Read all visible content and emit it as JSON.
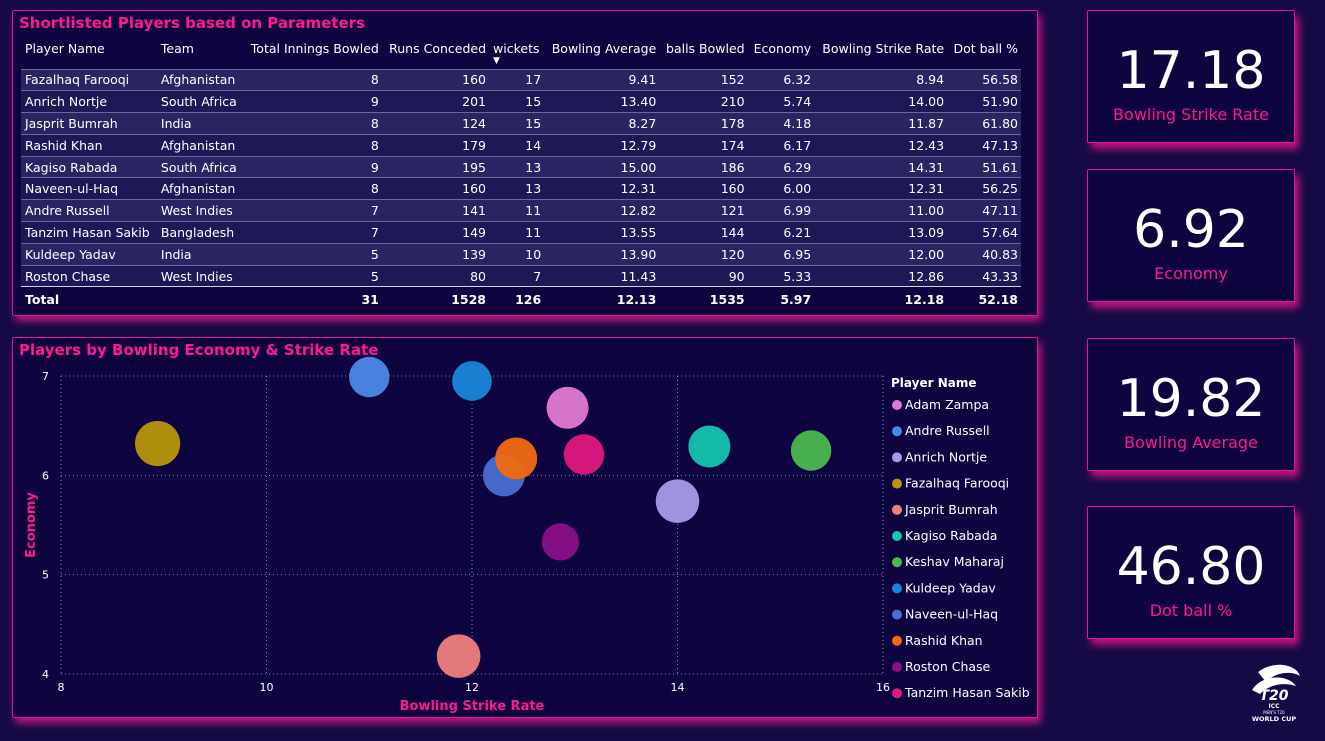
{
  "table": {
    "title": "Shortlisted Players based on Parameters",
    "columns": [
      "Player Name",
      "Team",
      "Total Innings Bowled",
      "Runs Conceded",
      "wickets",
      "Bowling Average",
      "balls Bowled",
      "Economy",
      "Bowling Strike Rate",
      "Dot ball %"
    ],
    "rows": [
      [
        "Fazalhaq Farooqi",
        "Afghanistan",
        "8",
        "160",
        "17",
        "9.41",
        "152",
        "6.32",
        "8.94",
        "56.58"
      ],
      [
        "Anrich Nortje",
        "South Africa",
        "9",
        "201",
        "15",
        "13.40",
        "210",
        "5.74",
        "14.00",
        "51.90"
      ],
      [
        "Jasprit Bumrah",
        "India",
        "8",
        "124",
        "15",
        "8.27",
        "178",
        "4.18",
        "11.87",
        "61.80"
      ],
      [
        "Rashid Khan",
        "Afghanistan",
        "8",
        "179",
        "14",
        "12.79",
        "174",
        "6.17",
        "12.43",
        "47.13"
      ],
      [
        "Kagiso Rabada",
        "South Africa",
        "9",
        "195",
        "13",
        "15.00",
        "186",
        "6.29",
        "14.31",
        "51.61"
      ],
      [
        "Naveen-ul-Haq",
        "Afghanistan",
        "8",
        "160",
        "13",
        "12.31",
        "160",
        "6.00",
        "12.31",
        "56.25"
      ],
      [
        "Andre Russell",
        "West Indies",
        "7",
        "141",
        "11",
        "12.82",
        "121",
        "6.99",
        "11.00",
        "47.11"
      ],
      [
        "Tanzim Hasan Sakib",
        "Bangladesh",
        "7",
        "149",
        "11",
        "13.55",
        "144",
        "6.21",
        "13.09",
        "57.64"
      ],
      [
        "Kuldeep Yadav",
        "India",
        "5",
        "139",
        "10",
        "13.90",
        "120",
        "6.95",
        "12.00",
        "40.83"
      ],
      [
        "Roston Chase",
        "West Indies",
        "5",
        "80",
        "7",
        "11.43",
        "90",
        "5.33",
        "12.86",
        "43.33"
      ]
    ],
    "total": [
      "Total",
      "",
      "31",
      "1528",
      "126",
      "12.13",
      "1535",
      "5.97",
      "12.18",
      "52.18"
    ],
    "sorted_column": "wickets"
  },
  "cards": [
    {
      "value": "17.18",
      "label": "Bowling Strike Rate"
    },
    {
      "value": "6.92",
      "label": "Economy"
    },
    {
      "value": "19.82",
      "label": "Bowling Average"
    },
    {
      "value": "46.80",
      "label": "Dot ball %"
    }
  ],
  "logo": {
    "text_lines": [
      "ICC",
      "MEN'S T20",
      "WORLD CUP"
    ],
    "icon": "t20-world-cup-logo-icon"
  },
  "chart_data": {
    "type": "scatter",
    "title": "Players by Bowling Economy & Strike Rate",
    "xlabel": "Bowling Strike Rate",
    "ylabel": "Economy",
    "xlim": [
      8,
      16
    ],
    "ylim": [
      4,
      7
    ],
    "xticks": [
      "8",
      "10",
      "12",
      "14",
      "16"
    ],
    "yticks": [
      "4",
      "5",
      "6",
      "7"
    ],
    "grid": true,
    "legend_title": "Player Name",
    "legend_position": "right",
    "series": [
      {
        "name": "Adam Zampa",
        "color": "#e07ad0",
        "x": 12.93,
        "y": 6.68,
        "size": 1.0
      },
      {
        "name": "Andre Russell",
        "color": "#4c88e8",
        "x": 11.0,
        "y": 6.99,
        "size": 0.9
      },
      {
        "name": "Anrich Nortje",
        "color": "#a79be8",
        "x": 14.0,
        "y": 5.74,
        "size": 1.1
      },
      {
        "name": "Fazalhaq Farooqi",
        "color": "#b8960c",
        "x": 8.94,
        "y": 6.32,
        "size": 1.2
      },
      {
        "name": "Jasprit Bumrah",
        "color": "#f08080",
        "x": 11.87,
        "y": 4.18,
        "size": 1.1
      },
      {
        "name": "Kagiso Rabada",
        "color": "#14c4b0",
        "x": 14.31,
        "y": 6.29,
        "size": 1.0
      },
      {
        "name": "Keshav Maharaj",
        "color": "#4cb850",
        "x": 15.3,
        "y": 6.25,
        "size": 0.9
      },
      {
        "name": "Kuldeep Yadav",
        "color": "#1a86d8",
        "x": 12.0,
        "y": 6.95,
        "size": 0.85
      },
      {
        "name": "Naveen-ul-Haq",
        "color": "#4a6ed0",
        "x": 12.31,
        "y": 6.0,
        "size": 1.0
      },
      {
        "name": "Rashid Khan",
        "color": "#f06a12",
        "x": 12.43,
        "y": 6.17,
        "size": 1.0
      },
      {
        "name": "Roston Chase",
        "color": "#8a1088",
        "x": 12.86,
        "y": 5.33,
        "size": 0.7
      },
      {
        "name": "Tanzim Hasan Sakib",
        "color": "#e01880",
        "x": 13.09,
        "y": 6.21,
        "size": 0.9
      }
    ]
  }
}
